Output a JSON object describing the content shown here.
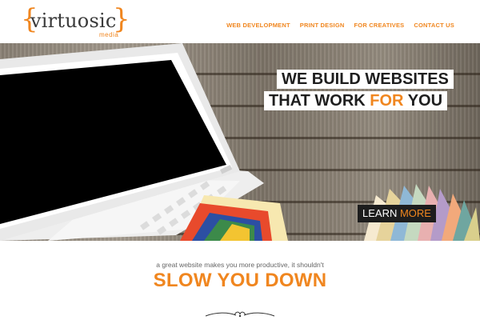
{
  "header": {
    "logo_word": "virtuosic",
    "logo_brace_left": "{",
    "logo_brace_right": "}",
    "logo_sub": "media"
  },
  "nav": {
    "items": [
      {
        "label": "WEB DEVELOPMENT"
      },
      {
        "label": "PRINT DESIGN"
      },
      {
        "label": "FOR CREATIVES"
      },
      {
        "label": "CONTACT US"
      }
    ]
  },
  "hero": {
    "headline_line1": "WE BUILD WEBSITES",
    "headline_line2_pre": "THAT WORK ",
    "headline_line2_accent": "FOR",
    "headline_line2_post": " YOU",
    "cta_pre": "LEARN ",
    "cta_accent": "MORE"
  },
  "content": {
    "tagline": "a great website makes you more productive, it shouldn't",
    "headline": "SLOW YOU DOWN"
  },
  "colors": {
    "accent": "#f0861f",
    "text_dark": "#1e1e1e",
    "logo_text": "#3a3a3a"
  }
}
